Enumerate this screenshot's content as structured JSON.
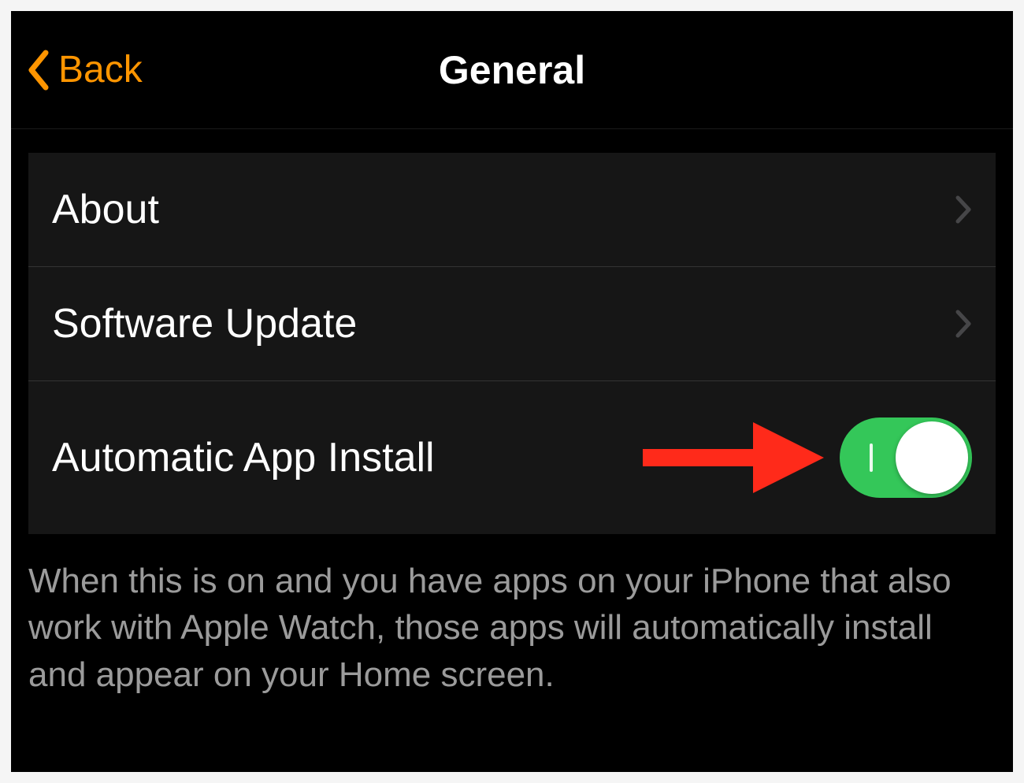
{
  "nav": {
    "back_label": "Back",
    "title": "General"
  },
  "settings": {
    "about_label": "About",
    "software_update_label": "Software Update",
    "auto_app_install_label": "Automatic App Install",
    "auto_app_install_enabled": true
  },
  "footer": {
    "description": "When this is on and you have apps on your iPhone that also work with Apple Watch, those apps will automatically install and appear on your Home screen."
  },
  "colors": {
    "accent": "#ff9500",
    "toggle_on": "#34c759",
    "annotation": "#ff2a1a"
  }
}
